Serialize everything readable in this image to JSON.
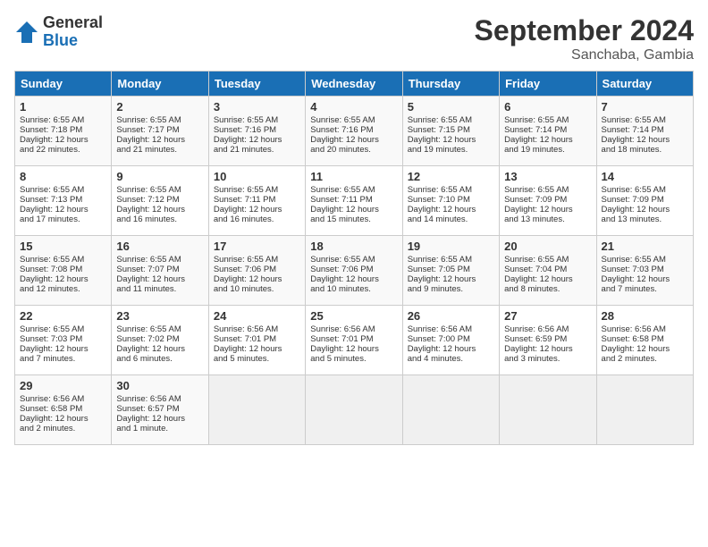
{
  "logo": {
    "general": "General",
    "blue": "Blue"
  },
  "title": "September 2024",
  "location": "Sanchaba, Gambia",
  "headers": [
    "Sunday",
    "Monday",
    "Tuesday",
    "Wednesday",
    "Thursday",
    "Friday",
    "Saturday"
  ],
  "weeks": [
    [
      {
        "day": "1",
        "lines": [
          "Sunrise: 6:55 AM",
          "Sunset: 7:18 PM",
          "Daylight: 12 hours",
          "and 22 minutes."
        ]
      },
      {
        "day": "2",
        "lines": [
          "Sunrise: 6:55 AM",
          "Sunset: 7:17 PM",
          "Daylight: 12 hours",
          "and 21 minutes."
        ]
      },
      {
        "day": "3",
        "lines": [
          "Sunrise: 6:55 AM",
          "Sunset: 7:16 PM",
          "Daylight: 12 hours",
          "and 21 minutes."
        ]
      },
      {
        "day": "4",
        "lines": [
          "Sunrise: 6:55 AM",
          "Sunset: 7:16 PM",
          "Daylight: 12 hours",
          "and 20 minutes."
        ]
      },
      {
        "day": "5",
        "lines": [
          "Sunrise: 6:55 AM",
          "Sunset: 7:15 PM",
          "Daylight: 12 hours",
          "and 19 minutes."
        ]
      },
      {
        "day": "6",
        "lines": [
          "Sunrise: 6:55 AM",
          "Sunset: 7:14 PM",
          "Daylight: 12 hours",
          "and 19 minutes."
        ]
      },
      {
        "day": "7",
        "lines": [
          "Sunrise: 6:55 AM",
          "Sunset: 7:14 PM",
          "Daylight: 12 hours",
          "and 18 minutes."
        ]
      }
    ],
    [
      {
        "day": "8",
        "lines": [
          "Sunrise: 6:55 AM",
          "Sunset: 7:13 PM",
          "Daylight: 12 hours",
          "and 17 minutes."
        ]
      },
      {
        "day": "9",
        "lines": [
          "Sunrise: 6:55 AM",
          "Sunset: 7:12 PM",
          "Daylight: 12 hours",
          "and 16 minutes."
        ]
      },
      {
        "day": "10",
        "lines": [
          "Sunrise: 6:55 AM",
          "Sunset: 7:11 PM",
          "Daylight: 12 hours",
          "and 16 minutes."
        ]
      },
      {
        "day": "11",
        "lines": [
          "Sunrise: 6:55 AM",
          "Sunset: 7:11 PM",
          "Daylight: 12 hours",
          "and 15 minutes."
        ]
      },
      {
        "day": "12",
        "lines": [
          "Sunrise: 6:55 AM",
          "Sunset: 7:10 PM",
          "Daylight: 12 hours",
          "and 14 minutes."
        ]
      },
      {
        "day": "13",
        "lines": [
          "Sunrise: 6:55 AM",
          "Sunset: 7:09 PM",
          "Daylight: 12 hours",
          "and 13 minutes."
        ]
      },
      {
        "day": "14",
        "lines": [
          "Sunrise: 6:55 AM",
          "Sunset: 7:09 PM",
          "Daylight: 12 hours",
          "and 13 minutes."
        ]
      }
    ],
    [
      {
        "day": "15",
        "lines": [
          "Sunrise: 6:55 AM",
          "Sunset: 7:08 PM",
          "Daylight: 12 hours",
          "and 12 minutes."
        ]
      },
      {
        "day": "16",
        "lines": [
          "Sunrise: 6:55 AM",
          "Sunset: 7:07 PM",
          "Daylight: 12 hours",
          "and 11 minutes."
        ]
      },
      {
        "day": "17",
        "lines": [
          "Sunrise: 6:55 AM",
          "Sunset: 7:06 PM",
          "Daylight: 12 hours",
          "and 10 minutes."
        ]
      },
      {
        "day": "18",
        "lines": [
          "Sunrise: 6:55 AM",
          "Sunset: 7:06 PM",
          "Daylight: 12 hours",
          "and 10 minutes."
        ]
      },
      {
        "day": "19",
        "lines": [
          "Sunrise: 6:55 AM",
          "Sunset: 7:05 PM",
          "Daylight: 12 hours",
          "and 9 minutes."
        ]
      },
      {
        "day": "20",
        "lines": [
          "Sunrise: 6:55 AM",
          "Sunset: 7:04 PM",
          "Daylight: 12 hours",
          "and 8 minutes."
        ]
      },
      {
        "day": "21",
        "lines": [
          "Sunrise: 6:55 AM",
          "Sunset: 7:03 PM",
          "Daylight: 12 hours",
          "and 7 minutes."
        ]
      }
    ],
    [
      {
        "day": "22",
        "lines": [
          "Sunrise: 6:55 AM",
          "Sunset: 7:03 PM",
          "Daylight: 12 hours",
          "and 7 minutes."
        ]
      },
      {
        "day": "23",
        "lines": [
          "Sunrise: 6:55 AM",
          "Sunset: 7:02 PM",
          "Daylight: 12 hours",
          "and 6 minutes."
        ]
      },
      {
        "day": "24",
        "lines": [
          "Sunrise: 6:56 AM",
          "Sunset: 7:01 PM",
          "Daylight: 12 hours",
          "and 5 minutes."
        ]
      },
      {
        "day": "25",
        "lines": [
          "Sunrise: 6:56 AM",
          "Sunset: 7:01 PM",
          "Daylight: 12 hours",
          "and 5 minutes."
        ]
      },
      {
        "day": "26",
        "lines": [
          "Sunrise: 6:56 AM",
          "Sunset: 7:00 PM",
          "Daylight: 12 hours",
          "and 4 minutes."
        ]
      },
      {
        "day": "27",
        "lines": [
          "Sunrise: 6:56 AM",
          "Sunset: 6:59 PM",
          "Daylight: 12 hours",
          "and 3 minutes."
        ]
      },
      {
        "day": "28",
        "lines": [
          "Sunrise: 6:56 AM",
          "Sunset: 6:58 PM",
          "Daylight: 12 hours",
          "and 2 minutes."
        ]
      }
    ],
    [
      {
        "day": "29",
        "lines": [
          "Sunrise: 6:56 AM",
          "Sunset: 6:58 PM",
          "Daylight: 12 hours",
          "and 2 minutes."
        ]
      },
      {
        "day": "30",
        "lines": [
          "Sunrise: 6:56 AM",
          "Sunset: 6:57 PM",
          "Daylight: 12 hours",
          "and 1 minute."
        ]
      },
      null,
      null,
      null,
      null,
      null
    ]
  ]
}
